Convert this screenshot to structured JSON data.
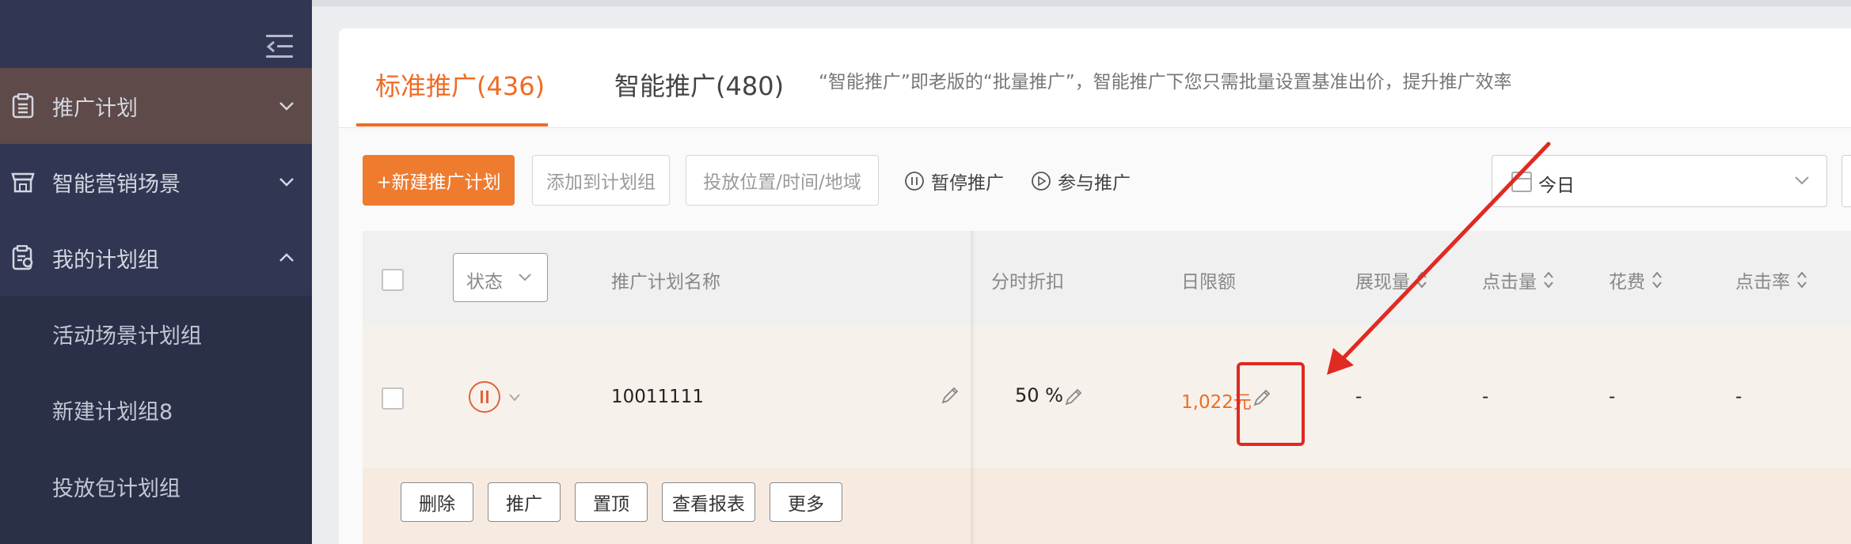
{
  "sidebar": {
    "items": [
      {
        "label": "推广计划",
        "icon": "clipboard-icon",
        "expanded": false
      },
      {
        "label": "智能营销场景",
        "icon": "store-icon",
        "expanded": false
      },
      {
        "label": "我的计划组",
        "icon": "group-clipboard-icon",
        "expanded": true
      }
    ],
    "subitems": [
      "活动场景计划组",
      "新建计划组8",
      "投放包计划组"
    ]
  },
  "tabs": [
    {
      "label": "标准推广(436)",
      "active": true
    },
    {
      "label": "智能推广(480)",
      "active": false
    }
  ],
  "tab_note": "“智能推广”即老版的“批量推广”，智能推广下您只需批量设置基准出价，提升推广效率",
  "toolbar": {
    "new_plan": "+新建推广计划",
    "add_to_group": "添加到计划组",
    "placement": "投放位置/时间/地域",
    "pause": "暂停推广",
    "join": "参与推广",
    "date_value": "今日"
  },
  "table": {
    "headers": {
      "status": "状态",
      "name": "推广计划名称",
      "discount": "分时折扣",
      "daily_limit": "日限额",
      "impressions": "展现量",
      "clicks": "点击量",
      "cost": "花费",
      "ctr": "点击率"
    },
    "rows": [
      {
        "name": "10011111",
        "discount": "50 %",
        "daily_limit": "1,022元",
        "impressions": "-",
        "clicks": "-",
        "cost": "-",
        "ctr": "-"
      }
    ],
    "row_actions": [
      "删除",
      "推广",
      "置顶",
      "查看报表",
      "更多"
    ]
  },
  "colors": {
    "accent": "#ef6b24",
    "sidebar_bg": "#313753",
    "annotation": "#e02a22"
  }
}
